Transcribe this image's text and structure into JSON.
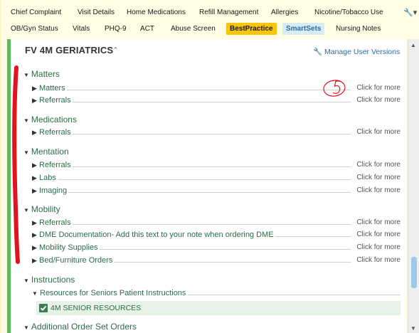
{
  "tabs_row1": [
    "Chief Complaint",
    "Visit Details",
    "Home Medications",
    "Refill Management",
    "Allergies",
    "Nicotine/Tobacco Use"
  ],
  "tabs_row2": [
    "OB/Gyn Status",
    "Vitals",
    "PHQ-9",
    "ACT",
    "Abuse Screen",
    "BestPractice",
    "SmartSets",
    "Nursing Notes"
  ],
  "toolbar_icon": "wrench-icon",
  "panel": {
    "title": "FV 4M GERIATRICS",
    "manage_label": "Manage User Versions"
  },
  "sections": [
    {
      "label": "Matters",
      "rows": [
        {
          "label": "Matters",
          "more": "Click for more"
        },
        {
          "label": "Referrals",
          "more": "Click for more"
        }
      ]
    },
    {
      "label": "Medications",
      "rows": [
        {
          "label": "Referrals",
          "more": "Click for more"
        }
      ]
    },
    {
      "label": "Mentation",
      "rows": [
        {
          "label": "Referrals",
          "more": "Click for more"
        },
        {
          "label": "Labs",
          "more": "Click for more"
        },
        {
          "label": "Imaging",
          "more": "Click for more"
        }
      ]
    },
    {
      "label": "Mobility",
      "rows": [
        {
          "label": "Referrals",
          "more": "Click for more"
        },
        {
          "label": "DME Documentation- Add this text to your note when ordering DME",
          "more": "Click for more"
        },
        {
          "label": "Mobility Supplies",
          "more": "Click for more"
        },
        {
          "label": "Bed/Furniture Orders",
          "more": "Click for more"
        }
      ]
    },
    {
      "label": "Instructions"
    },
    {
      "label": "Additional Order Set Orders"
    }
  ],
  "instructions": {
    "subsection": "Resources for Seniors Patient Instructions",
    "item": "4M SENIOR RESOURCES",
    "item_checked": true
  },
  "colors": {
    "accent_green": "#5fb85f",
    "highlight_tab": "#f8c50a",
    "link_blue": "#2a6ea0",
    "annotation_red": "#e0141e"
  }
}
